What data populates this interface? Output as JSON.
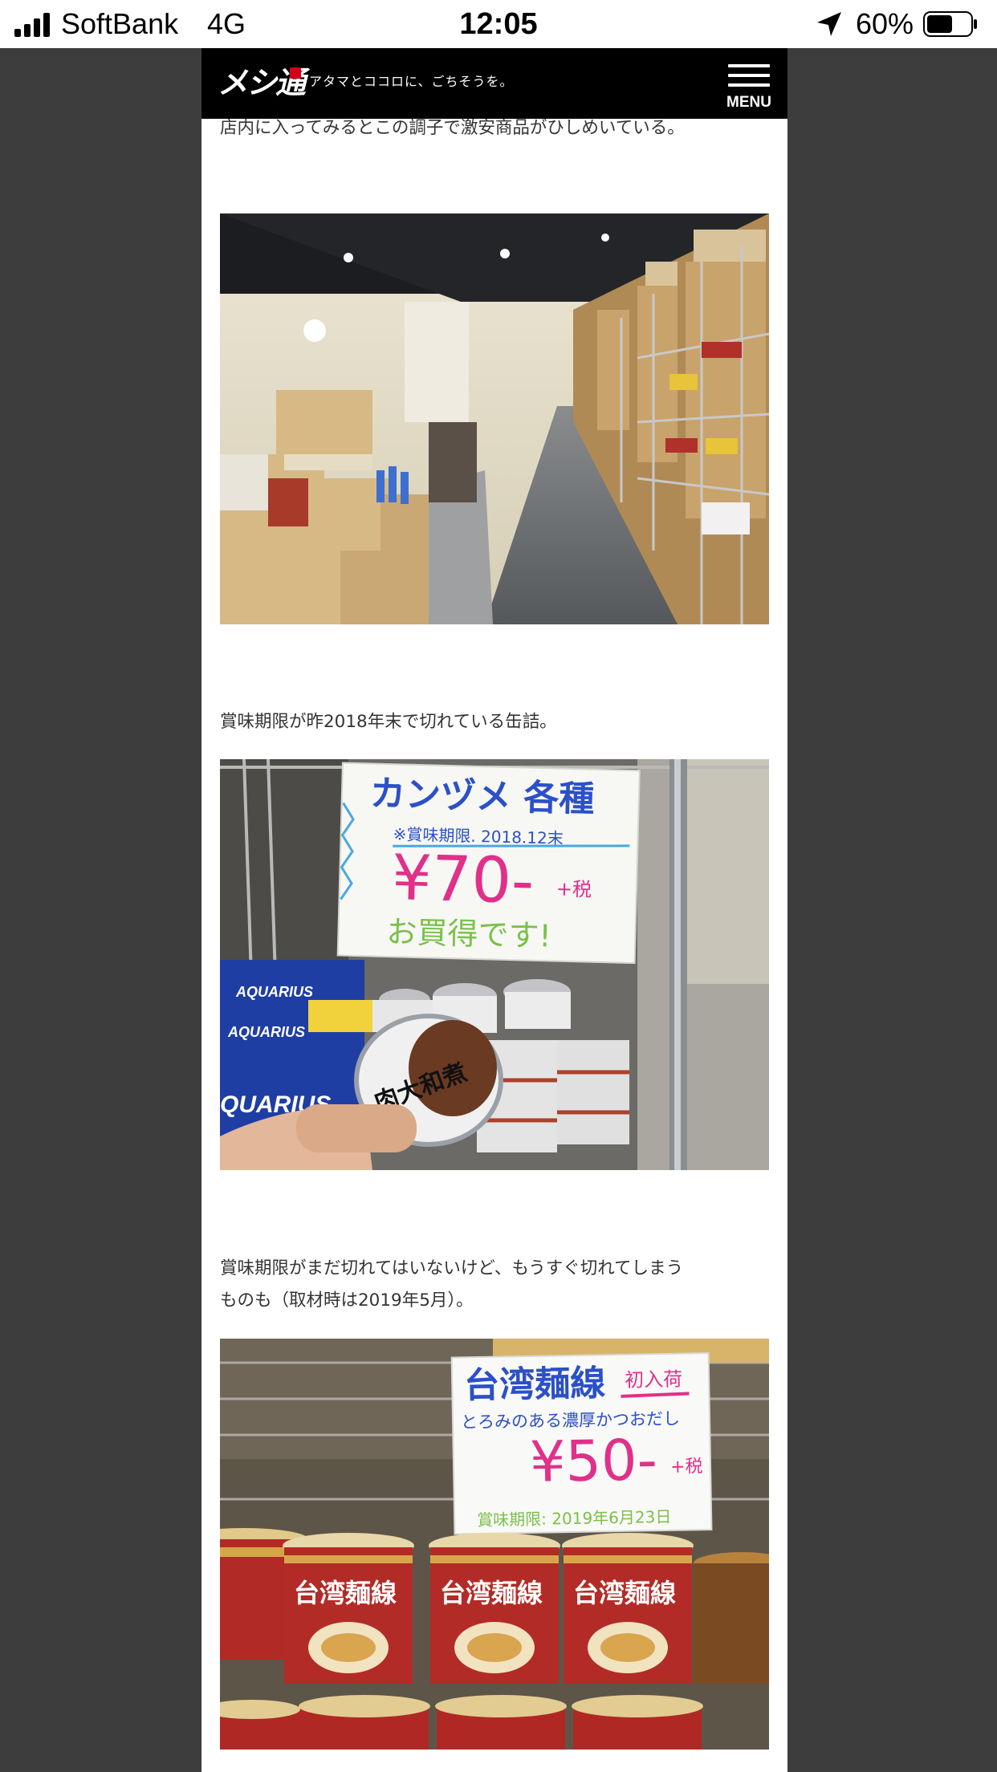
{
  "status_bar": {
    "carrier": "SoftBank",
    "network": "4G",
    "time": "12:05",
    "battery_percent": "60%",
    "battery_level": 0.6
  },
  "header": {
    "logo": "メシ通",
    "tagline": "アタマとココロに、ごちそうを。",
    "menu_label": "MENU"
  },
  "article": {
    "paragraph_1": "店内に入ってみるとこの調子で激安商品がひしめいている。",
    "paragraph_2": "賞味期限が昨2018年末で切れている缶詰。",
    "paragraph_3_line1": "賞味期限がまだ切れてはいないけど、もうすぐ切れてしまう",
    "paragraph_3_line2": "ものも（取材時は2019年5月）。"
  },
  "photo_2_sign": {
    "title": "カンヅメ 各種",
    "expiry": "※賞味期限. 2018.12末",
    "price": "¥70-",
    "tax": "+税",
    "note": "お買得です!",
    "can_label": "肉大和煮"
  },
  "photo_3_sign": {
    "title": "台湾麺線",
    "badge": "初入荷",
    "subtitle": "とろみのある濃厚かつおだし",
    "price": "¥50-",
    "tax": "+税",
    "expiry": "賞味期限: 2019年6月23日",
    "cup_label": "台湾麺線"
  },
  "colors": {
    "sign_blue": "#2b50c8",
    "sign_pink": "#e0308a",
    "sign_green": "#7ac04a",
    "header_bg": "#000000",
    "text": "#333333"
  }
}
